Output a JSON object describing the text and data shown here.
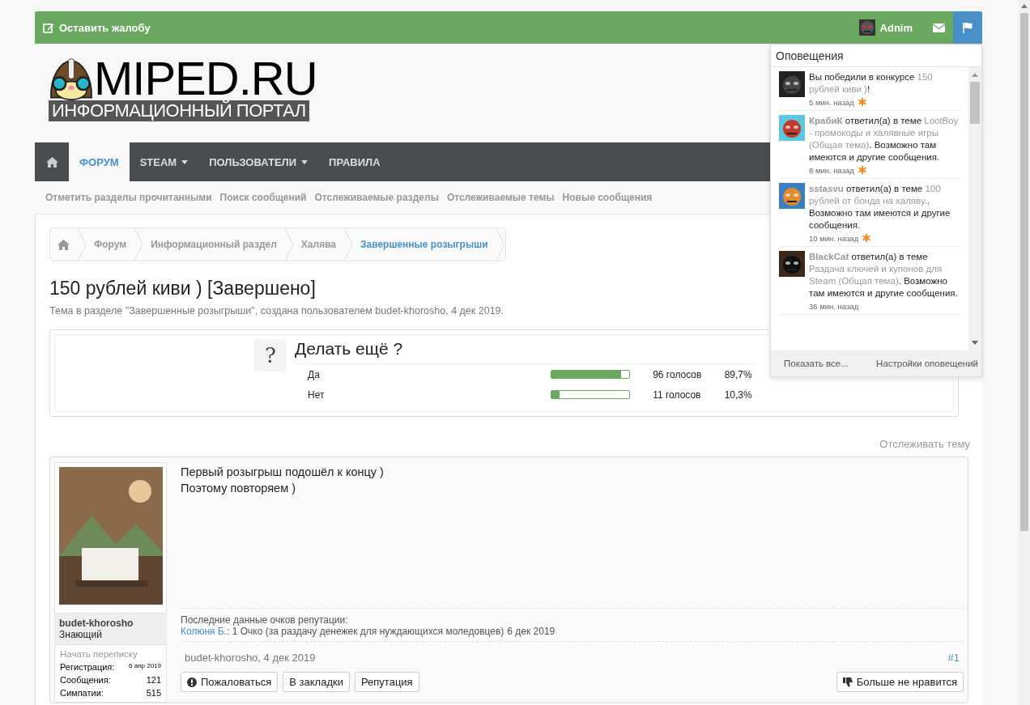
{
  "top_bar": {
    "complaint_link": "Оставить жалобу",
    "username": "Adnim"
  },
  "logo": {
    "title": "MIPED.RU",
    "subtitle": "ИНФОРМАЦИОННЫЙ ПОРТАЛ"
  },
  "nav": {
    "tabs": [
      {
        "kind": "home",
        "selected": false
      },
      {
        "kind": "text",
        "label": "ФОРУМ",
        "selected": true,
        "dropdown": false
      },
      {
        "kind": "text",
        "label": "STEAM",
        "selected": false,
        "dropdown": true
      },
      {
        "kind": "text",
        "label": "ПОЛЬЗОВАТЕЛИ",
        "selected": false,
        "dropdown": true
      },
      {
        "kind": "text",
        "label": "ПРАВИЛА",
        "selected": false,
        "dropdown": false
      }
    ]
  },
  "subnav": [
    "Отметить разделы прочитанными",
    "Поиск сообщений",
    "Отслеживаемые разделы",
    "Отслеживаемые темы",
    "Новые сообщения"
  ],
  "breadcrumbs": [
    {
      "kind": "home",
      "selected": false
    },
    {
      "kind": "text",
      "label": "Форум",
      "selected": false
    },
    {
      "kind": "text",
      "label": "Информационный раздел",
      "selected": false
    },
    {
      "kind": "text",
      "label": "Халява",
      "selected": false
    },
    {
      "kind": "text",
      "label": "Завершенные розыгрыши",
      "selected": true
    }
  ],
  "thread": {
    "title": "150 рублей киви ) [Завершено]",
    "meta": "Тема в разделе \"Завершенные розыгрыши\", создана пользователем budet-khorosho, 4 дек 2019."
  },
  "poll": {
    "icon": "?",
    "question": "Делать ещё ?",
    "options": [
      {
        "label": "Да",
        "level": 0.897,
        "votes": "96 голосов",
        "percent": "89,7%"
      },
      {
        "label": "Нет",
        "level": 0.103,
        "votes": "11 голосов",
        "percent": "10,3%"
      }
    ]
  },
  "watch_link": "Отслеживать тему",
  "post": {
    "author": {
      "name": "budet-khorosho",
      "rank": "Знающий",
      "start_conversation": "Начать переписку",
      "stats": [
        {
          "label": "Регистрация:",
          "value": "6 апр 2019",
          "small": true
        },
        {
          "label": "Сообщения:",
          "value": "121",
          "small": false
        },
        {
          "label": "Симпатии:",
          "value": "515",
          "small": false
        }
      ]
    },
    "body": [
      "Первый розыгрыш подошёл к концу )",
      "Поэтому повторяем )"
    ],
    "reputation": {
      "heading": "Последние данные очков репутации:",
      "giver": "Колюня Б.",
      "text": ": 1 Очко (за раздачу денежек для нуждающихся моледовцев)",
      "date": "6 дек 2019"
    },
    "footer": {
      "author_date": "budet-khorosho, 4 дек 2019",
      "number": "#1"
    },
    "buttons": [
      {
        "kind": "report",
        "label": "Пожаловаться"
      },
      {
        "kind": "plain",
        "label": "В закладки"
      },
      {
        "kind": "plain",
        "label": "Репутация"
      }
    ],
    "dislike_button": "Больше не нравится"
  },
  "notifications": {
    "title": "Оповещения",
    "items": [
      {
        "action": "Вы победили в конкурсе ",
        "link": "150 рублей киви )",
        "tail": "!",
        "time": "5 мин. назад",
        "unread": true
      },
      {
        "user": "КрабиК",
        "action": " ответил(а) в теме ",
        "link": "LootBoy - промокоды и халявные игры (Общая тема)",
        "tail": ". Возможно там имеются и другие сообщения.",
        "time": "8 мин. назад",
        "unread": true
      },
      {
        "user": "sstasvu",
        "action": " ответил(а) в теме ",
        "link": "100 рублей от бонда на халяву.",
        "tail": ". Возможно там имеются и другие сообщения.",
        "time": "10 мин. назад",
        "unread": true
      },
      {
        "user": "BlackCat",
        "action": " ответил(а) в теме ",
        "link": "Раздача ключей и купонов для Steam (Общая тема)",
        "tail": ". Возможно там имеются и другие сообщения.",
        "time": "36 мин. назад",
        "unread": false
      }
    ],
    "footer": [
      "Показать все...",
      "Настройки оповещений"
    ]
  }
}
